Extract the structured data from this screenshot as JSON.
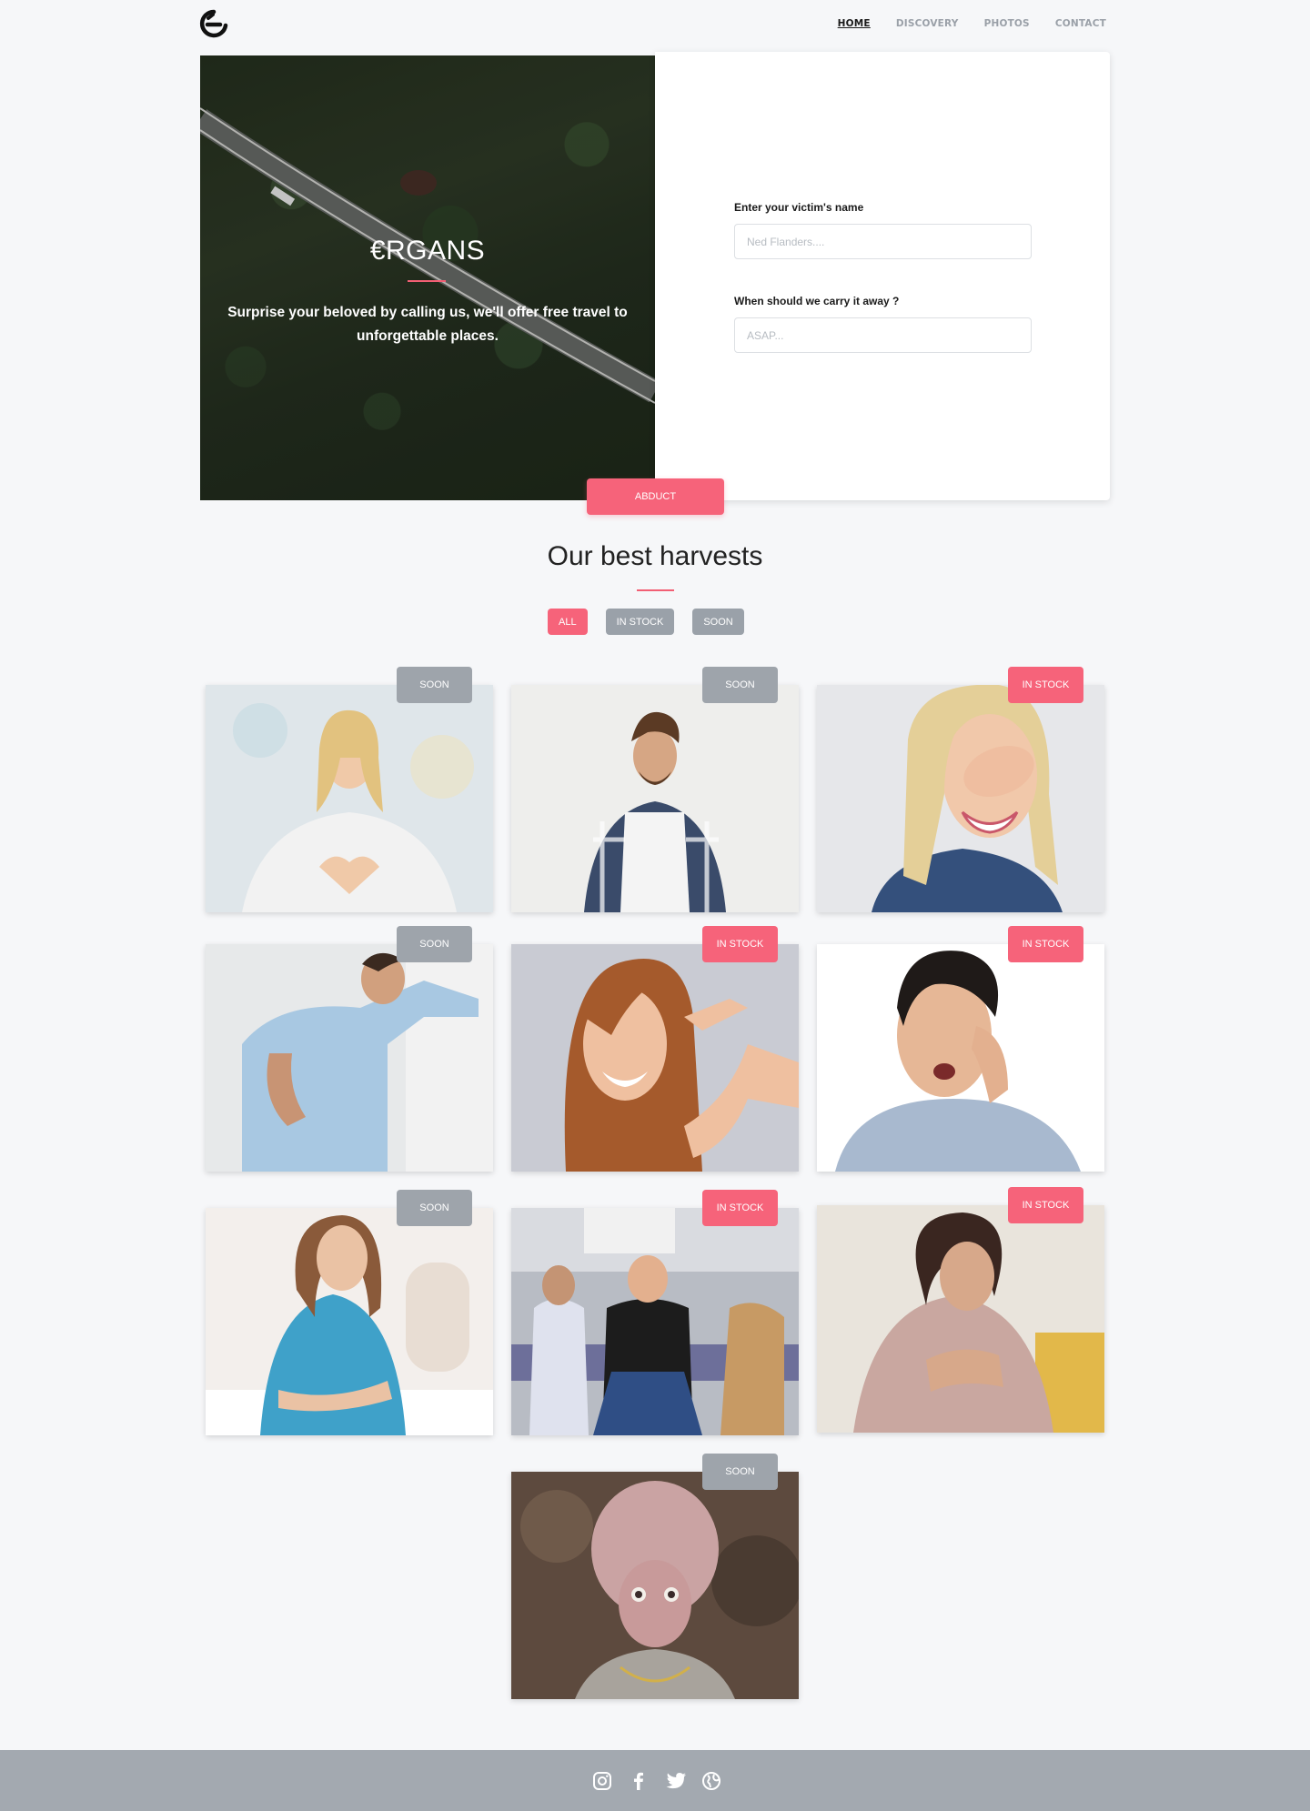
{
  "header": {
    "logo_icon": "e-logo-icon",
    "nav": [
      {
        "label": "HOME",
        "active": true
      },
      {
        "label": "DISCOVERY",
        "active": false
      },
      {
        "label": "PHOTOS",
        "active": false
      },
      {
        "label": "CONTACT",
        "active": false
      }
    ]
  },
  "hero": {
    "title": "€RGANS",
    "text": "Surprise your beloved by calling us, we'll offer free travel to unforgettable places.",
    "form": {
      "name_label": "Enter your victim's name",
      "name_placeholder": "Ned Flanders....",
      "time_label": "When should we carry it away ?",
      "time_placeholder": "ASAP...",
      "submit_label": "ABDUCT"
    }
  },
  "harvests": {
    "title": "Our best harvests",
    "filters": [
      {
        "label": "ALL",
        "active": true
      },
      {
        "label": "IN STOCK",
        "active": false
      },
      {
        "label": "SOON",
        "active": false
      }
    ],
    "items": [
      {
        "status": "SOON",
        "photo": "woman-heart-hands-photo"
      },
      {
        "status": "SOON",
        "photo": "man-plaid-shirt-photo"
      },
      {
        "status": "IN STOCK",
        "photo": "woman-covering-eye-photo"
      },
      {
        "status": "SOON",
        "photo": "man-back-pain-photo"
      },
      {
        "status": "IN STOCK",
        "photo": "woman-finger-gun-photo"
      },
      {
        "status": "IN STOCK",
        "photo": "man-toothache-photo"
      },
      {
        "status": "SOON",
        "photo": "woman-stomach-ache-photo"
      },
      {
        "status": "IN STOCK",
        "photo": "subway-passengers-photo"
      },
      {
        "status": "IN STOCK",
        "photo": "woman-chest-pain-photo"
      },
      {
        "status": "SOON",
        "photo": "alien-big-head-photo"
      }
    ]
  },
  "footer": {
    "social": [
      "instagram-icon",
      "facebook-icon",
      "twitter-icon",
      "globe-icon"
    ]
  },
  "colors": {
    "accent": "#f6637a",
    "badge_soon": "#9ea4ab",
    "footer": "#a3a9b0",
    "background": "#f6f7f9"
  }
}
